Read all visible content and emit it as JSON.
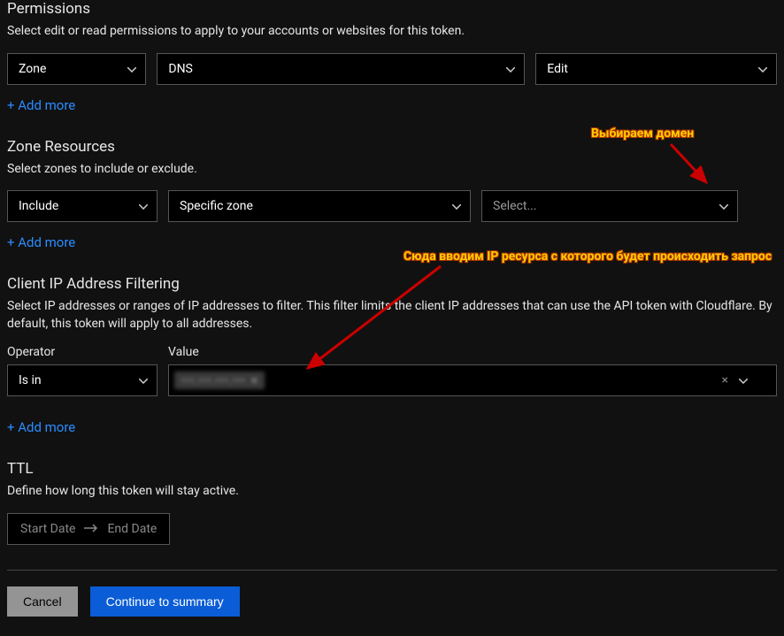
{
  "permissions": {
    "title": "Permissions",
    "desc": "Select edit or read permissions to apply to your accounts or websites for this token.",
    "scope": "Zone",
    "resource": "DNS",
    "level": "Edit",
    "add_more": "+ Add more"
  },
  "zone_resources": {
    "title": "Zone Resources",
    "desc": "Select zones to include or exclude.",
    "mode": "Include",
    "type": "Specific zone",
    "domain_placeholder": "Select...",
    "add_more": "+ Add more"
  },
  "ip_filtering": {
    "title": "Client IP Address Filtering",
    "desc": "Select IP addresses or ranges of IP addresses to filter. This filter limits the client IP addresses that can use the API token with Cloudflare. By default, this token will apply to all addresses.",
    "operator_label": "Operator",
    "value_label": "Value",
    "operator": "Is in",
    "value_tag": "•••.•••.•••.•••",
    "add_more": "+ Add more"
  },
  "ttl": {
    "title": "TTL",
    "desc": "Define how long this token will stay active.",
    "start": "Start Date",
    "end": "End Date"
  },
  "actions": {
    "cancel": "Cancel",
    "continue": "Continue to summary"
  },
  "annotations": {
    "domain": "Выбираем домен",
    "ip": "Сюда вводим IP ресурса с которого будет происходить запрос"
  }
}
